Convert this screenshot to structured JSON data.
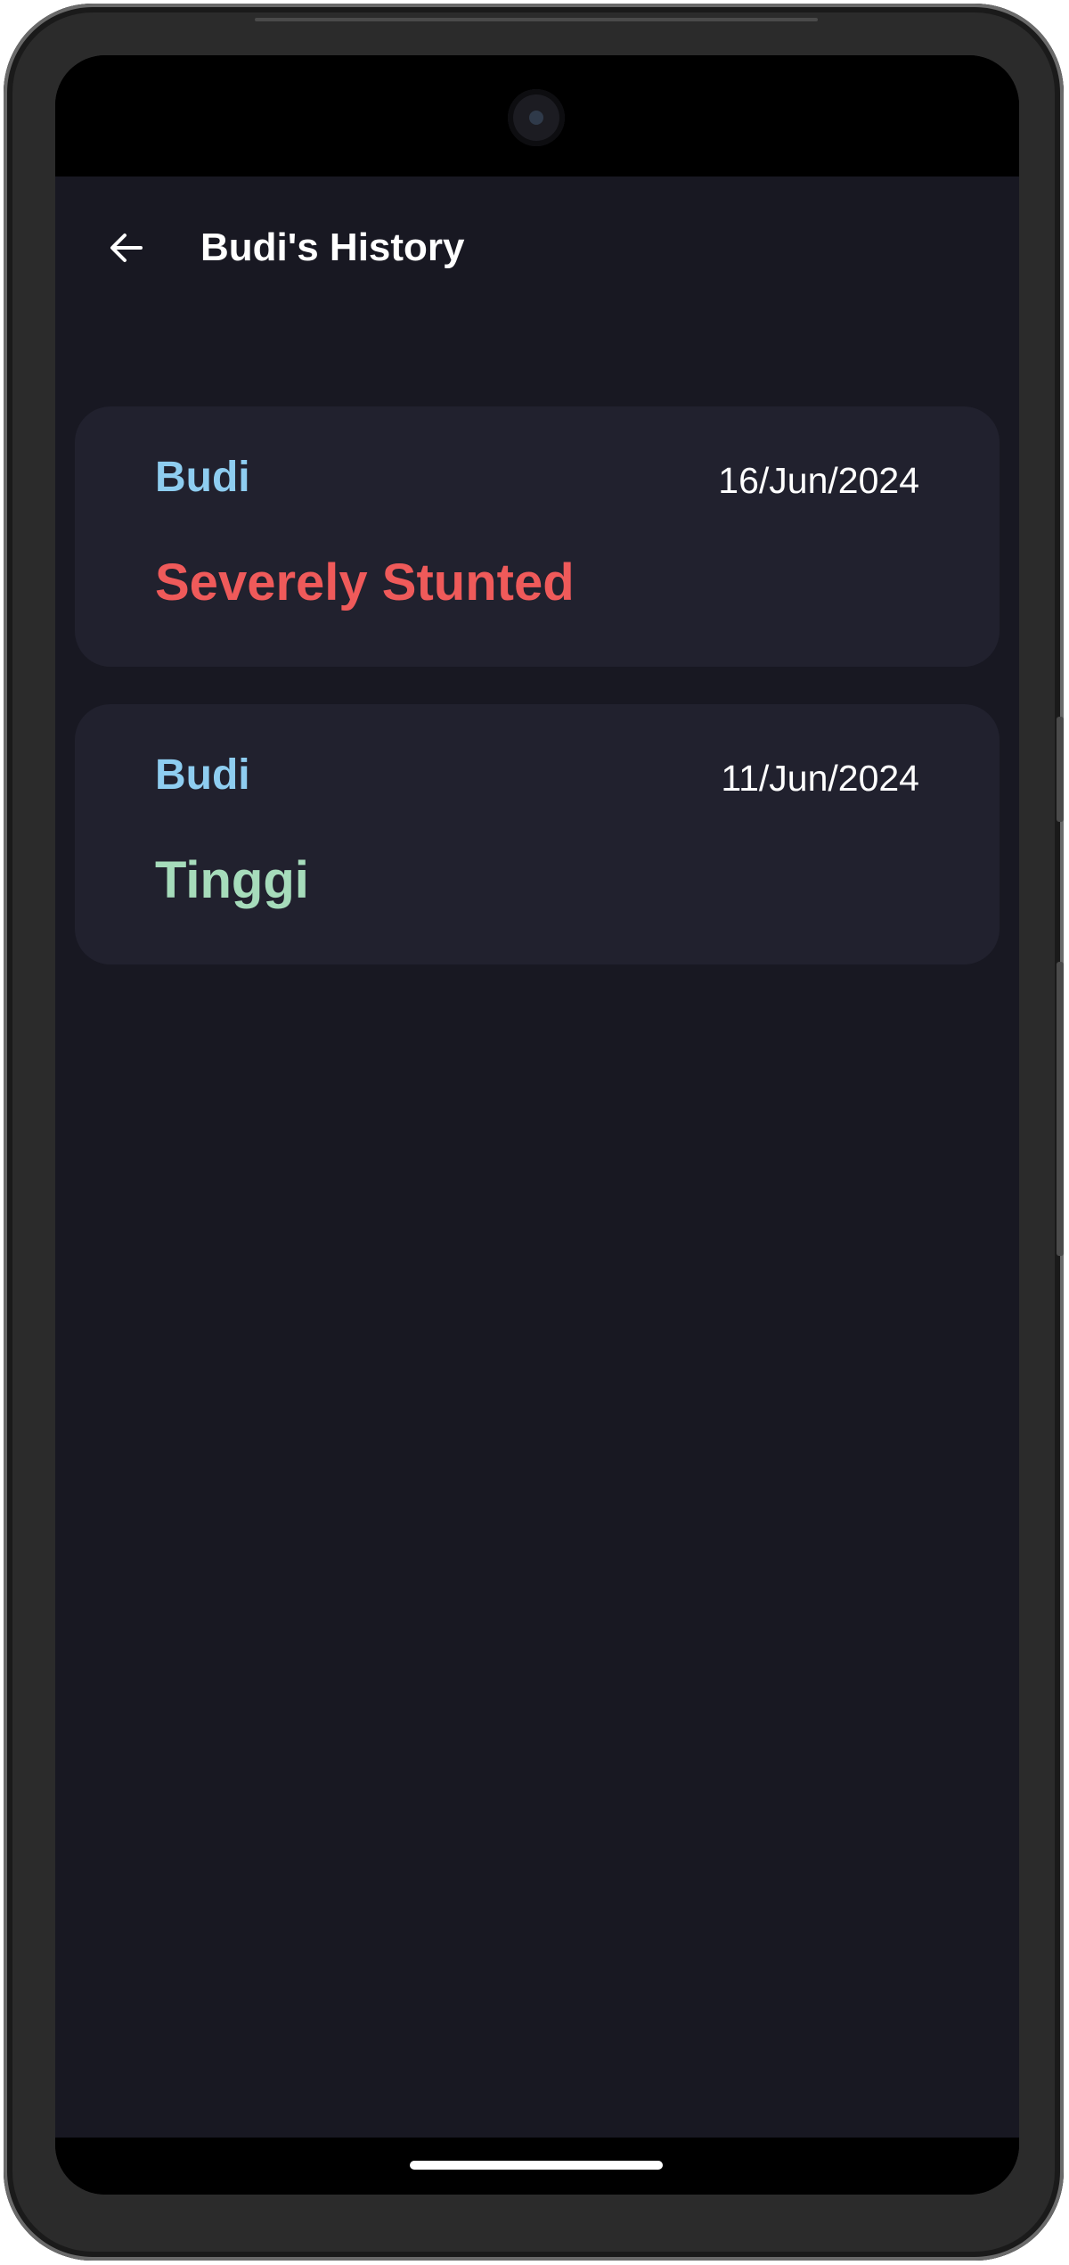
{
  "app_bar": {
    "title": "Budi's History",
    "back_icon": "arrow-left-icon"
  },
  "history": [
    {
      "name": "Budi",
      "date": "16/Jun/2024",
      "status": "Severely Stunted",
      "status_color": "#ef5a5a"
    },
    {
      "name": "Budi",
      "date": "11/Jun/2024",
      "status": "Tinggi",
      "status_color": "#a6dcbb"
    }
  ],
  "colors": {
    "background": "#181822",
    "card": "#21212e",
    "name_accent": "#8ecdf0",
    "text": "#ffffff"
  }
}
